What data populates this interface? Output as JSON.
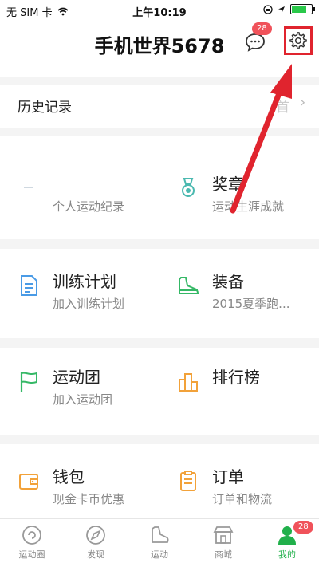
{
  "status": {
    "carrier": "无 SIM 卡",
    "time": "上午10:19"
  },
  "header": {
    "title": "手机世界5678",
    "message_badge": "28"
  },
  "history": {
    "label": "历史记录",
    "ghost_text": "首"
  },
  "grid": [
    {
      "title": "",
      "subtitle": "个人运动纪录",
      "icon": "blank"
    },
    {
      "title": "奖章",
      "subtitle": "运动生涯成就",
      "icon": "medal-icon"
    },
    {
      "title": "训练计划",
      "subtitle": "加入训练计划",
      "icon": "document-icon"
    },
    {
      "title": "装备",
      "subtitle": "2015夏季跑...",
      "icon": "shoe-icon"
    },
    {
      "title": "运动团",
      "subtitle": "加入运动团",
      "icon": "flag-icon"
    },
    {
      "title": "排行榜",
      "subtitle": "",
      "icon": "podium-icon"
    },
    {
      "title": "钱包",
      "subtitle": "现金卡币优惠",
      "icon": "wallet-icon"
    },
    {
      "title": "订单",
      "subtitle": "订单和物流",
      "icon": "clipboard-icon"
    }
  ],
  "tabs": [
    {
      "label": "运动圈",
      "icon": "circle-icon"
    },
    {
      "label": "发现",
      "icon": "compass-icon"
    },
    {
      "label": "运动",
      "icon": "run-icon"
    },
    {
      "label": "商城",
      "icon": "shop-icon"
    },
    {
      "label": "我的",
      "icon": "person-icon",
      "active": true
    }
  ],
  "tab_badge": "28",
  "colors": {
    "accent_green": "#21b04b",
    "badge_red": "#f0525a",
    "highlight_red": "#e0242e",
    "doc_blue": "#4a9be6",
    "wallet_orange": "#f2a23a"
  }
}
